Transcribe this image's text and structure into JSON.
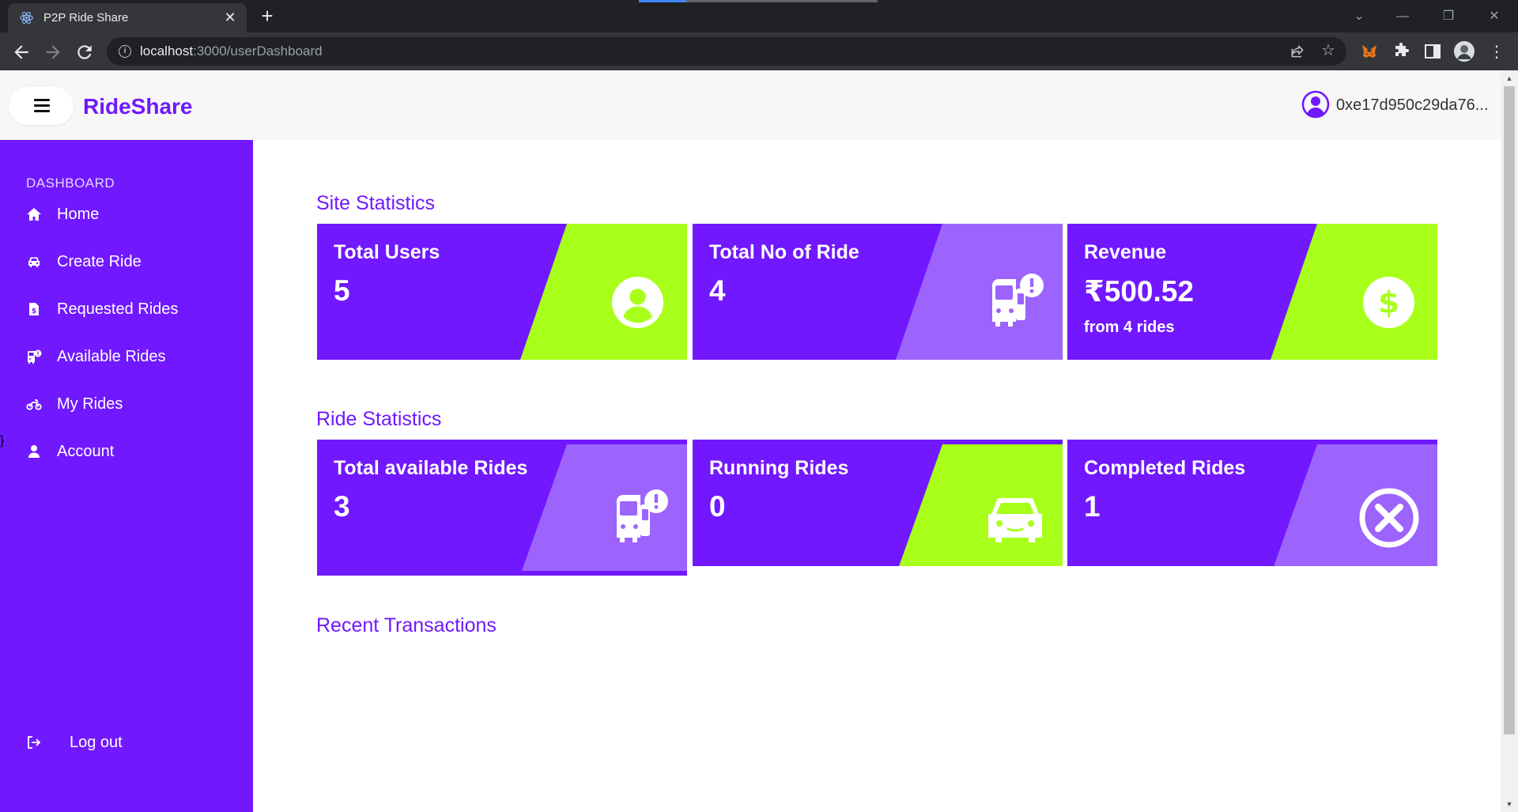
{
  "browser": {
    "tab_title": "P2P Ride Share",
    "tab_close": "✕",
    "new_tab": "+",
    "url_host": "localhost",
    "url_path": ":3000/userDashboard"
  },
  "header": {
    "brand": "RideShare",
    "user_address": "0xe17d950c29da76..."
  },
  "sidebar": {
    "heading": "DASHBOARD",
    "items": [
      {
        "label": "Home",
        "icon": "home-icon"
      },
      {
        "label": "Create Ride",
        "icon": "car-icon"
      },
      {
        "label": "Requested Rides",
        "icon": "file-dollar-icon"
      },
      {
        "label": "Available Rides",
        "icon": "bus-alert-icon"
      },
      {
        "label": "My Rides",
        "icon": "motorcycle-icon"
      },
      {
        "label": "Account",
        "icon": "user-icon"
      }
    ],
    "logout": "Log out"
  },
  "sections": {
    "site": "Site Statistics",
    "ride": "Ride Statistics",
    "transactions": "Recent Transactions"
  },
  "site_cards": [
    {
      "title": "Total Users",
      "value": "5",
      "icon": "user-circle-icon",
      "accent": "#a8ff1a"
    },
    {
      "title": "Total No of Ride",
      "value": "4",
      "icon": "bus-alert-icon",
      "accent": "#9d63fd"
    },
    {
      "title": "Revenue",
      "value": "₹500.52",
      "sub": "from 4 rides",
      "icon": "dollar-circle-icon",
      "accent": "#a8ff1a"
    }
  ],
  "ride_cards": [
    {
      "title": "Total available Rides",
      "value": "3",
      "icon": "bus-alert-icon",
      "accent": "#9d63fd"
    },
    {
      "title": "Running Rides",
      "value": "0",
      "icon": "car-front-icon",
      "accent": "#a8ff1a"
    },
    {
      "title": "Completed Rides",
      "value": "1",
      "icon": "x-circle-icon",
      "accent": "#9d63fd"
    }
  ],
  "colors": {
    "primary": "#7118fe",
    "lime": "#a8ff1a",
    "lavender": "#9d63fd"
  }
}
